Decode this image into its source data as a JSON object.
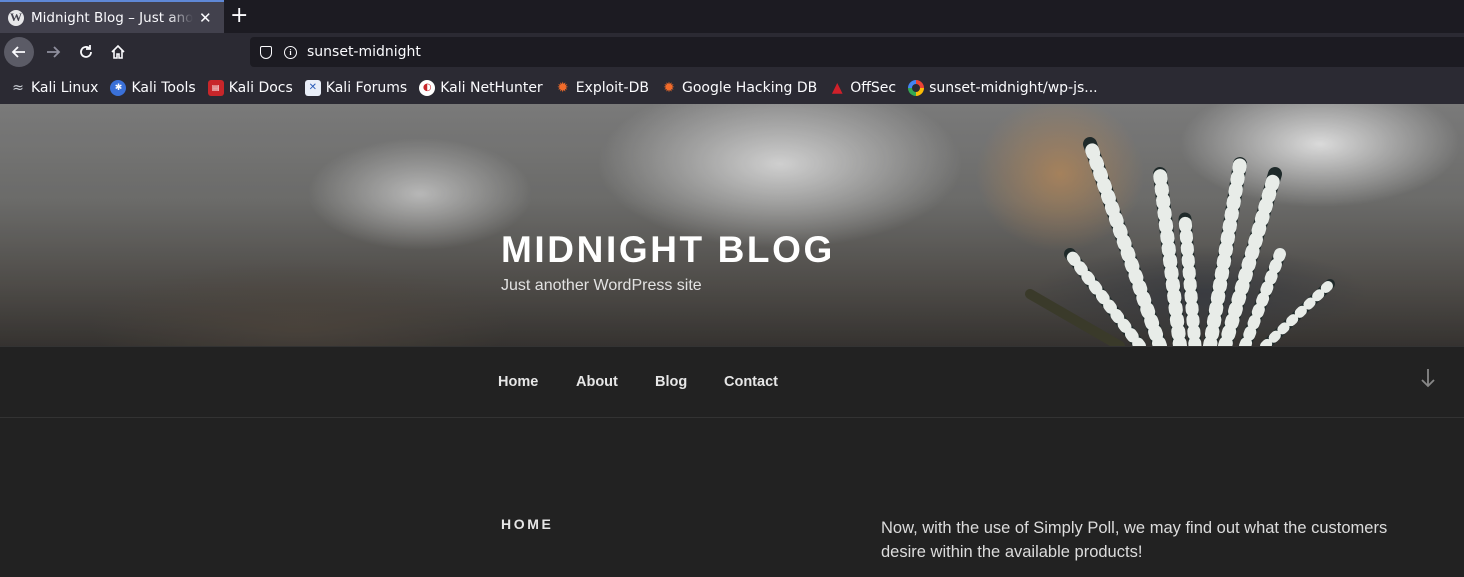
{
  "browser": {
    "tab_title": "Midnight Blog – Just another WordPress site",
    "tab_close": "✕",
    "new_tab": "+",
    "url": "sunset-midnight",
    "bookmarks": [
      {
        "label": "Kali Linux",
        "icon": "kali-dragon-icon"
      },
      {
        "label": "Kali Tools",
        "icon": "kali-tools-icon"
      },
      {
        "label": "Kali Docs",
        "icon": "kali-docs-icon"
      },
      {
        "label": "Kali Forums",
        "icon": "kali-forums-icon"
      },
      {
        "label": "Kali NetHunter",
        "icon": "kali-nethunter-icon"
      },
      {
        "label": "Exploit-DB",
        "icon": "exploit-db-icon"
      },
      {
        "label": "Google Hacking DB",
        "icon": "ghdb-icon"
      },
      {
        "label": "OffSec",
        "icon": "offsec-icon"
      },
      {
        "label": "sunset-midnight/wp-js...",
        "icon": "google-icon"
      }
    ]
  },
  "site": {
    "title": "MIDNIGHT BLOG",
    "tagline": "Just another WordPress site"
  },
  "menu": {
    "items": [
      "Home",
      "About",
      "Blog",
      "Contact"
    ]
  },
  "content": {
    "heading": "HOME",
    "text": "Now, with the use of Simply Poll, we may find out what the customers desire within the available products!"
  },
  "colors": {
    "tab_accent": "#5f88d6",
    "page_bg": "#222222"
  }
}
